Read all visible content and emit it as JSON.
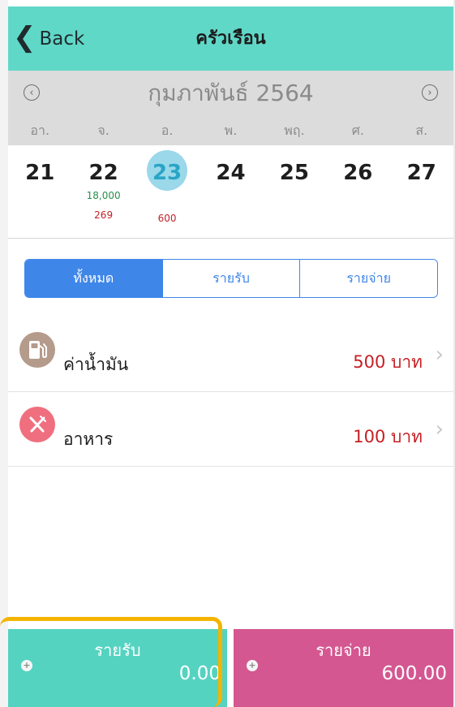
{
  "nav": {
    "back_label": "Back",
    "title": "ครัวเรือน"
  },
  "calendar": {
    "month_label": "กุมภาพันธ์ 2564",
    "weekdays": [
      "อา.",
      "จ.",
      "อ.",
      "พ.",
      "พฤ.",
      "ศ.",
      "ส."
    ],
    "days": [
      {
        "day": "21",
        "income": "",
        "expense": ""
      },
      {
        "day": "22",
        "income": "18,000",
        "expense": "269"
      },
      {
        "day": "23",
        "income": "",
        "expense": "600"
      },
      {
        "day": "24",
        "income": "",
        "expense": ""
      },
      {
        "day": "25",
        "income": "",
        "expense": ""
      },
      {
        "day": "26",
        "income": "",
        "expense": ""
      },
      {
        "day": "27",
        "income": "",
        "expense": ""
      }
    ],
    "selected_day": "23"
  },
  "filter": {
    "tabs": [
      "ทั้งหมด",
      "รายรับ",
      "รายจ่าย"
    ],
    "active_index": 0
  },
  "transactions": [
    {
      "name": "ค่าน้ำมัน",
      "amount": "500 บาท",
      "icon": "fuel-icon",
      "color": "#b59b8c"
    },
    {
      "name": "อาหาร",
      "amount": "100 บาท",
      "icon": "fork-knife-icon",
      "color": "#ef6f7f"
    }
  ],
  "summary": {
    "income_label": "รายรับ",
    "income_value": "0.00",
    "expense_label": "รายจ่าย",
    "expense_value": "600.00"
  },
  "colors": {
    "nav": "#60d8c8",
    "income": "#54d3c1",
    "expense": "#d45791",
    "accent": "#3f86e9",
    "highlight": "#f4b400"
  }
}
